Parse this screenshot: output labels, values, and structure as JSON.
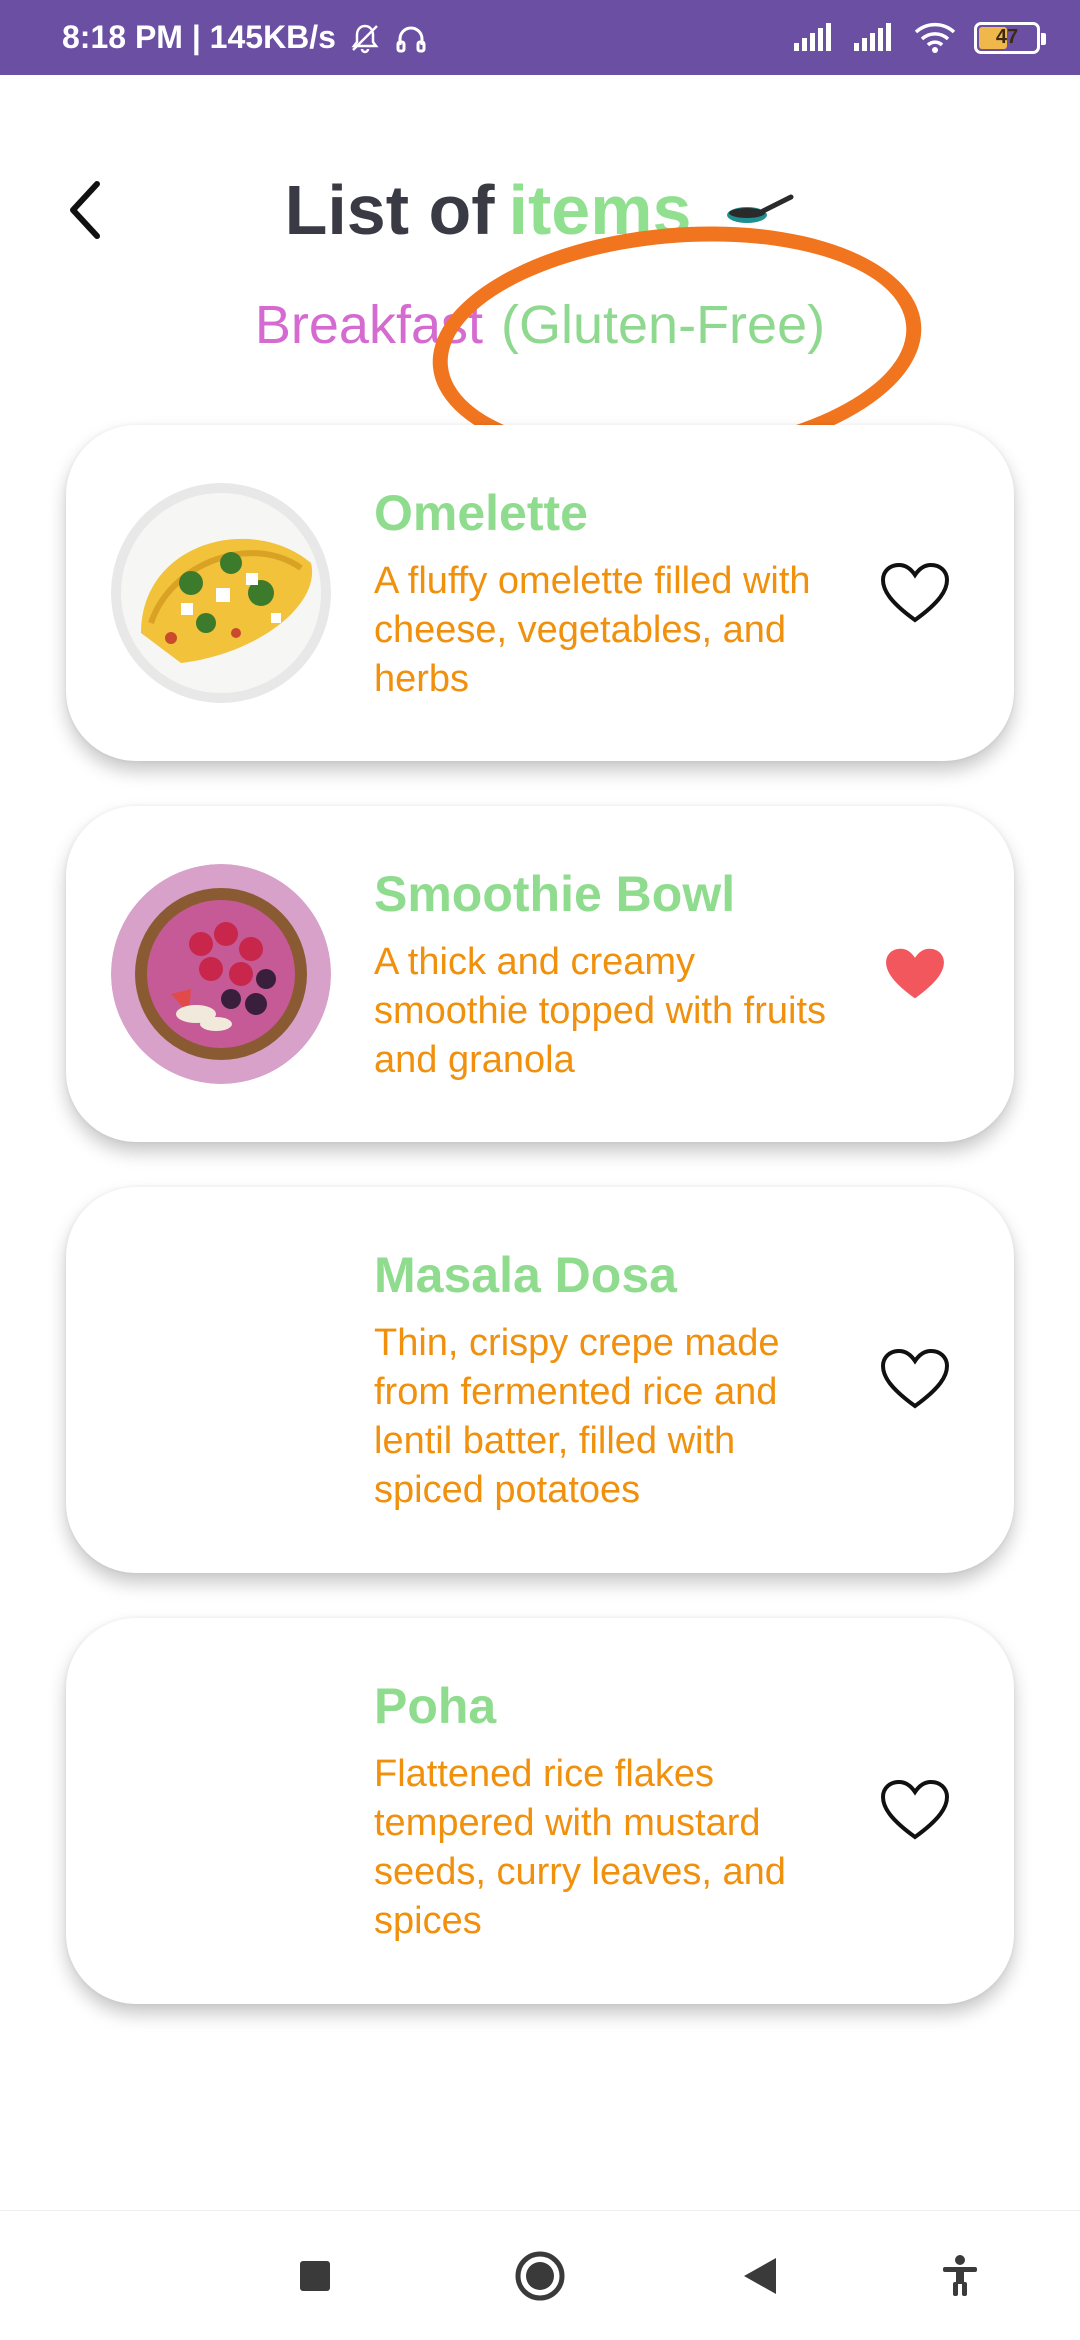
{
  "status_bar": {
    "time_speed": "8:18 PM | 145KB/s",
    "battery_level": "47",
    "background": "#6a4fa3"
  },
  "header": {
    "title_part1": "List of",
    "title_part2": "items",
    "category": "Breakfast",
    "filter": "(Gluten-Free)",
    "back_icon": "chevron-left-icon",
    "pan_icon": "frying-pan-icon"
  },
  "items": [
    {
      "title": "Omelette",
      "description": "A fluffy omelette filled with cheese, vegetables, and herbs",
      "image": "omelette-plate",
      "favorite": false
    },
    {
      "title": "Smoothie Bowl",
      "description": "A thick and creamy smoothie topped with fruits and granola",
      "image": "smoothie-bowl",
      "favorite": true
    },
    {
      "title": "Masala Dosa",
      "description": "Thin, crispy crepe made from fermented rice and lentil batter, filled with spiced potatoes",
      "image": "",
      "favorite": false
    },
    {
      "title": "Poha",
      "description": "Flattened rice flakes tempered with mustard seeds, curry leaves, and spices",
      "image": "",
      "favorite": false
    }
  ],
  "nav_bar": {
    "icons": [
      "square-icon",
      "circle-home-icon",
      "back-triangle-icon",
      "accessibility-icon"
    ]
  },
  "colors": {
    "title_dark": "#3a3a45",
    "title_green": "#90e090",
    "category_pink": "#d56bd1",
    "desc_orange": "#f0900c",
    "heart_red": "#f2575e",
    "annotation_orange": "#f1751e"
  }
}
